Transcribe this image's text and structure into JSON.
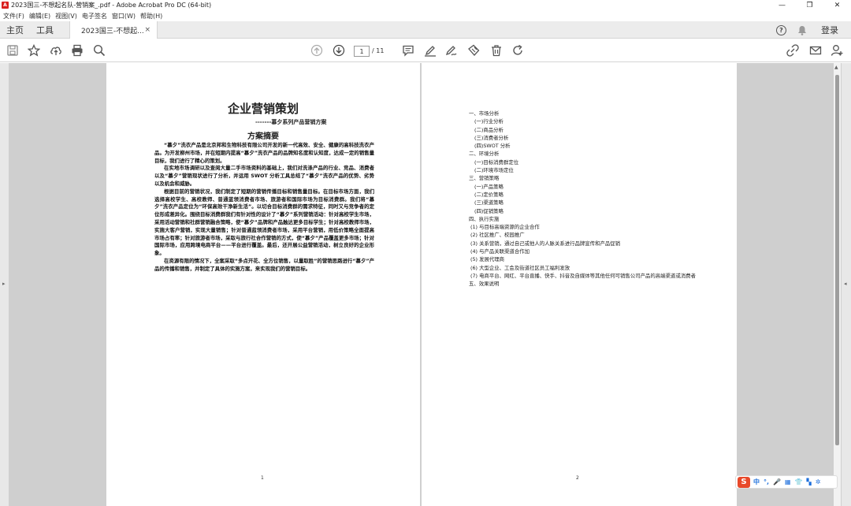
{
  "window": {
    "title": "2023国三-不想起名队-营销案_.pdf - Adobe Acrobat Pro DC (64-bit)",
    "app_icon_letter": "A",
    "minimize": "—",
    "restore": "❐",
    "close": "✕"
  },
  "menu": [
    "文件(F)",
    "编辑(E)",
    "视图(V)",
    "电子签名",
    "窗口(W)",
    "帮助(H)"
  ],
  "tabs": {
    "home": "主页",
    "tools": "工具",
    "document": "2023国三-不想起...",
    "close": "×",
    "help": "?",
    "login": "登录"
  },
  "toolbar": {
    "current_page": "1",
    "total_pages": "/ 11",
    "icons": [
      "save-icon",
      "star-icon",
      "upload-icon",
      "print-icon",
      "search-icon",
      "page-up-icon",
      "page-down-icon",
      "comment-icon",
      "highlight-pen-icon",
      "sign-icon",
      "stamp-icon",
      "delete-icon",
      "redo-icon",
      "link-share-icon",
      "mail-icon",
      "user-add-icon"
    ]
  },
  "page1": {
    "title": "企业营销策划",
    "subtitle": "-------慕夕系列产品营销方案",
    "heading": "方案摘要",
    "paragraphs": [
      "“慕夕”洗衣产品是北京邦和生物科技有限公司开发的新一代高效、安全、健康的高科技洗衣产品。为开发柳州市场，并在短期内提高“慕夕”洗衣产品的品牌知名度和认知度，达成一定的销售量目标，我们进行了精心的策划。",
      "在实地市场调研以及查阅大量二手市场资料的基础上，我们对洗涤产品的行业、竞品、消费者以及“慕夕”营销现状进行了分析，并运用 SWOT 分析工具总结了“慕夕”洗衣产品的优势、劣势以及机会和威胁。",
      "根据目前的营销状况，我们制定了短期的营销传播目标和销售量目标。在目标市场方面，我们选择高校学生、高校教师、普通蓝领消费者市场、旅游者和国际市场为目标消费群。我们将“慕夕”洗衣产品定位为“环保高效干净新生活”。以切合目标消费群的需求特征，同时又与竞争者的定位形成差异化。围绕目标消费群我们有针对性的设计了“慕夕”系列营销活动：针对高校学生市场，采用活动营销和社群营销融合策略，使“慕夕”品牌和产品触达更多目标学生；针对高校教师市场，实施大客户营销，实现大量销售；针对普通蓝领消费者市场，采用平台营销，用低价策略全面提高市场占有率；针对旅游者市场，采取与旅行社合作营销的方式，使“慕夕”产品覆盖更多市场；针对国际市场，应用跨境电商平台——平台进行覆盖。最后，还开展公益营销活动，树立良好的企业形象。",
      "在资源有限的情况下，全案采取“多点开花、全方位销售，以量取胜”的营销思路进行“慕夕”产品的传播和销售，并制定了具体的实施方案，来实现我们的营销目标。"
    ],
    "page_number": "1"
  },
  "page2": {
    "toc": [
      {
        "text": "一、市场分析",
        "level": 1
      },
      {
        "text": "(一)行业分析",
        "level": 2
      },
      {
        "text": "(二)商品分析",
        "level": 2
      },
      {
        "text": "(三)消费者分析",
        "level": 2
      },
      {
        "text": "(四)SWOT 分析",
        "level": 2
      },
      {
        "text": "二、环境分析",
        "level": 1
      },
      {
        "text": "(一)目标消费群定位",
        "level": 2
      },
      {
        "text": "(二)环境市场定位",
        "level": 2
      },
      {
        "text": "三、营销策略",
        "level": 1
      },
      {
        "text": "(一)产品策略",
        "level": 2
      },
      {
        "text": "(二)定价策略",
        "level": 2
      },
      {
        "text": "(三)渠道策略",
        "level": 2
      },
      {
        "text": "(四)促销策略",
        "level": 2
      },
      {
        "text": "四、执行实施",
        "level": 1
      },
      {
        "text": "(1) 与目标高端资源的企业合作",
        "level": 3
      },
      {
        "text": "(2) 社区推广、校园推广",
        "level": 3
      },
      {
        "text": "(3) 关系营销，通过自己或他人的人脉关系进行品牌宣传和产品促销",
        "level": 3
      },
      {
        "text": "(4) 与产品关联渠道合作加",
        "level": 3
      },
      {
        "text": "(5) 发展代理商",
        "level": 3
      },
      {
        "text": "(6) 大型企业、工会及街道社区员工福利发放",
        "level": 3
      },
      {
        "text": "(7) 电商平台、网红、平台直播、快手、抖音及自媒体等其他任何可销售公司产品的高端渠道或消费者",
        "level": 3
      },
      {
        "text": "五、效果说明",
        "level": 1
      }
    ],
    "page_number": "2"
  },
  "ime": {
    "logo": "S",
    "items": [
      "中",
      "°,",
      "🎤",
      "▦",
      "👕",
      "▚",
      "✲"
    ]
  },
  "colors": {
    "accent_red": "#d9201f",
    "viewer_bg": "#cfcfcf",
    "ime_blue": "#1d6fdc",
    "ime_logo": "#e8492a"
  }
}
